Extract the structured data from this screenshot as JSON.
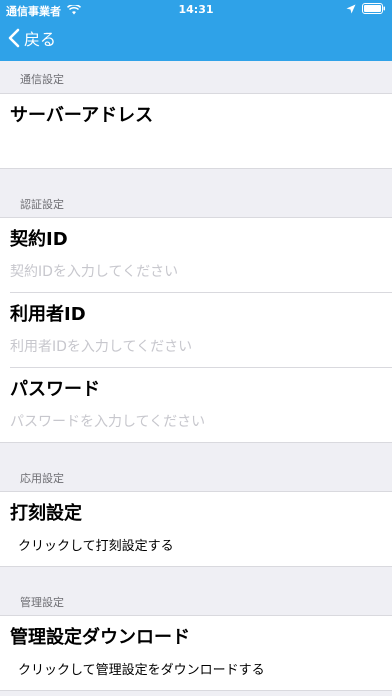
{
  "status_bar": {
    "carrier": "通信事業者",
    "time": "14:31"
  },
  "nav": {
    "back_label": "戻る"
  },
  "sections": {
    "communication": {
      "header": "通信設定",
      "server_address": {
        "title": "サーバーアドレス",
        "value": ""
      }
    },
    "authentication": {
      "header": "認証設定",
      "contract_id": {
        "title": "契約ID",
        "placeholder": "契約IDを入力してください"
      },
      "user_id": {
        "title": "利用者ID",
        "placeholder": "利用者IDを入力してください"
      },
      "password": {
        "title": "パスワード",
        "placeholder": "パスワードを入力してください"
      }
    },
    "application": {
      "header": "応用設定",
      "punch_settings": {
        "title": "打刻設定",
        "subtitle": "クリックして打刻設定する"
      }
    },
    "management": {
      "header": "管理設定",
      "download": {
        "title": "管理設定ダウンロード",
        "subtitle": "クリックして管理設定をダウンロードする"
      }
    }
  },
  "colors": {
    "accent": "#2fa2e8",
    "background": "#efeff4",
    "placeholder": "#c7c7cd"
  }
}
